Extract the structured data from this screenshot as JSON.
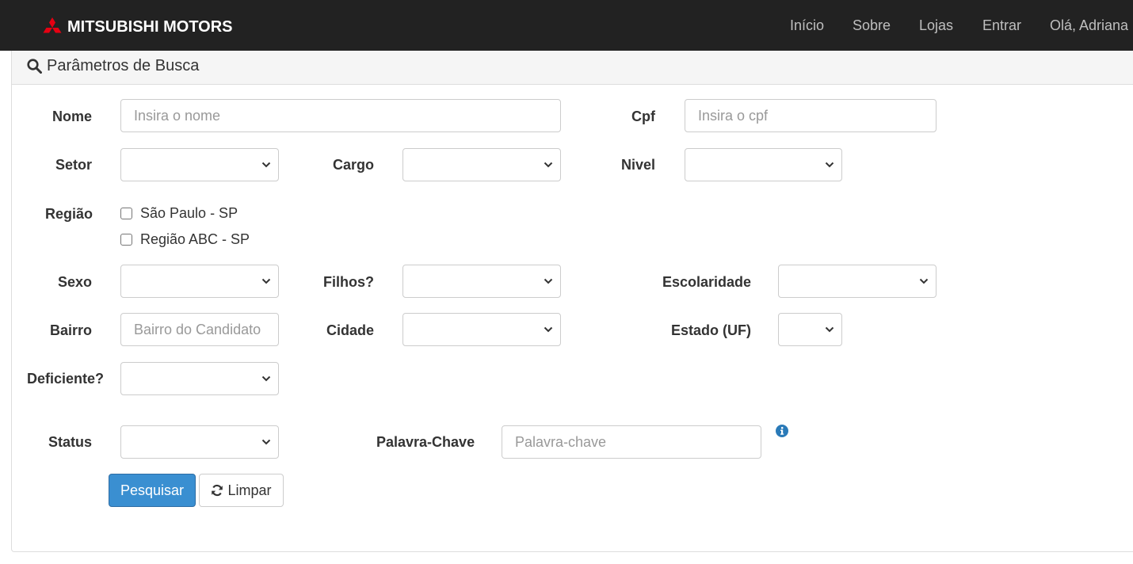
{
  "navbar": {
    "brand": "MITSUBISHI MOTORS",
    "links": [
      "Início",
      "Sobre",
      "Lojas",
      "Entrar",
      "Olá, Adriana"
    ]
  },
  "panel": {
    "title": "Parâmetros de Busca"
  },
  "form": {
    "nome": {
      "label": "Nome",
      "placeholder": "Insira o nome"
    },
    "cpf": {
      "label": "Cpf",
      "placeholder": "Insira o cpf"
    },
    "setor": {
      "label": "Setor"
    },
    "cargo": {
      "label": "Cargo"
    },
    "nivel": {
      "label": "Nivel"
    },
    "regiao": {
      "label": "Região",
      "options": [
        "São Paulo - SP",
        "Região ABC - SP"
      ]
    },
    "sexo": {
      "label": "Sexo"
    },
    "filhos": {
      "label": "Filhos?"
    },
    "escolaridade": {
      "label": "Escolaridade"
    },
    "bairro": {
      "label": "Bairro",
      "placeholder": "Bairro do Candidato"
    },
    "cidade": {
      "label": "Cidade"
    },
    "estado": {
      "label": "Estado (UF)"
    },
    "deficiente": {
      "label": "Deficiente?"
    },
    "status": {
      "label": "Status"
    },
    "palavra": {
      "label": "Palavra-Chave",
      "placeholder": "Palavra-chave"
    }
  },
  "buttons": {
    "search": "Pesquisar",
    "clear": "Limpar"
  },
  "colors": {
    "navbar": "#222222",
    "primary": "#3a8fd1",
    "brand_red": "#e60012",
    "info": "#2a7ab8"
  }
}
